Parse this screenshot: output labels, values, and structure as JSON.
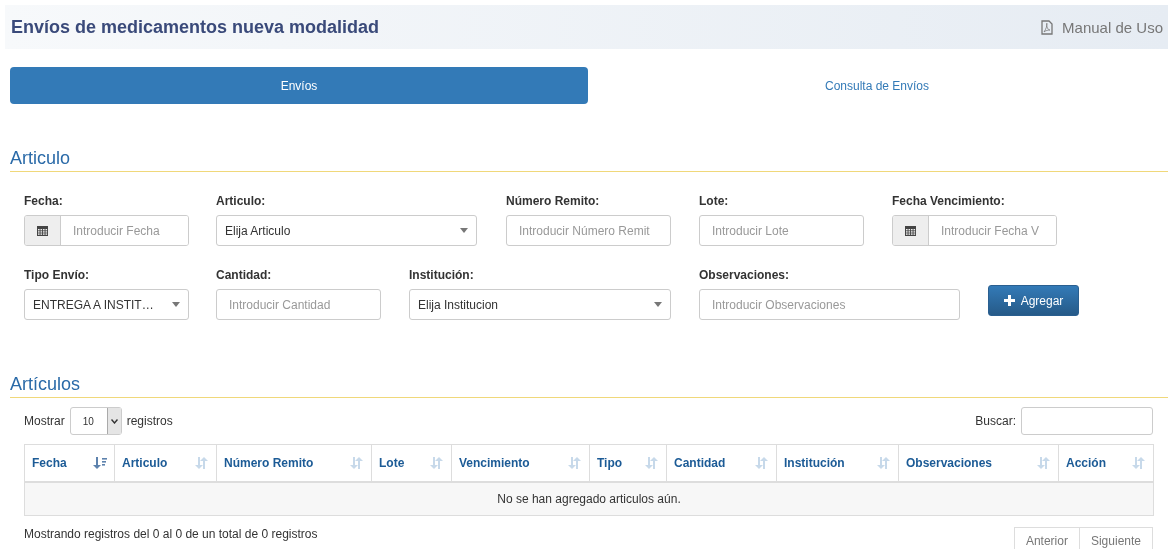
{
  "header": {
    "title": "Envíos de medicamentos nueva modalidad",
    "manual_link": "Manual de Uso"
  },
  "tabs": [
    {
      "label": "Envíos",
      "selected": true
    },
    {
      "label": "Consulta de Envíos",
      "selected": false
    }
  ],
  "form": {
    "title": "Articulo",
    "rows": [
      [
        {
          "kind": "date",
          "label": "Fecha:",
          "placeholder": "Introducir Fecha"
        },
        {
          "kind": "select",
          "label": "Articulo:",
          "value": "Elija Articulo"
        },
        {
          "kind": "text",
          "label": "Número Remito:",
          "placeholder": "Introducir Número Remit"
        },
        {
          "kind": "text",
          "label": "Lote:",
          "placeholder": "Introducir Lote"
        },
        {
          "kind": "date",
          "label": "Fecha Vencimiento:",
          "placeholder": "Introducir Fecha V"
        }
      ],
      [
        {
          "kind": "select",
          "label": "Tipo Envío:",
          "value": "ENTREGA A INSTIT…"
        },
        {
          "kind": "text",
          "label": "Cantidad:",
          "placeholder": "Introducir Cantidad"
        },
        {
          "kind": "select",
          "label": "Institución:",
          "value": "Elija Institucion"
        },
        {
          "kind": "text",
          "label": "Observaciones:",
          "placeholder": "Introducir Observaciones"
        }
      ]
    ],
    "add_button": "Agregar"
  },
  "table": {
    "title": "Artículos",
    "show_label": "Mostrar",
    "page_size": "10",
    "records_label": "registros",
    "search_label": "Buscar:",
    "columns": [
      {
        "label": "Fecha",
        "sorted": true
      },
      {
        "label": "Articulo",
        "sorted": false
      },
      {
        "label": "Número Remito",
        "sorted": false
      },
      {
        "label": "Lote",
        "sorted": false
      },
      {
        "label": "Vencimiento",
        "sorted": false
      },
      {
        "label": "Tipo",
        "sorted": false
      },
      {
        "label": "Cantidad",
        "sorted": false
      },
      {
        "label": "Institución",
        "sorted": false
      },
      {
        "label": "Observaciones",
        "sorted": false
      },
      {
        "label": "Acción",
        "sorted": false
      }
    ],
    "empty_message": "No se han agregado articulos aún.",
    "info": "Mostrando registros del 0 al 0 de un total de 0 registros",
    "pagination": [
      "Anterior",
      "Siguiente"
    ]
  }
}
